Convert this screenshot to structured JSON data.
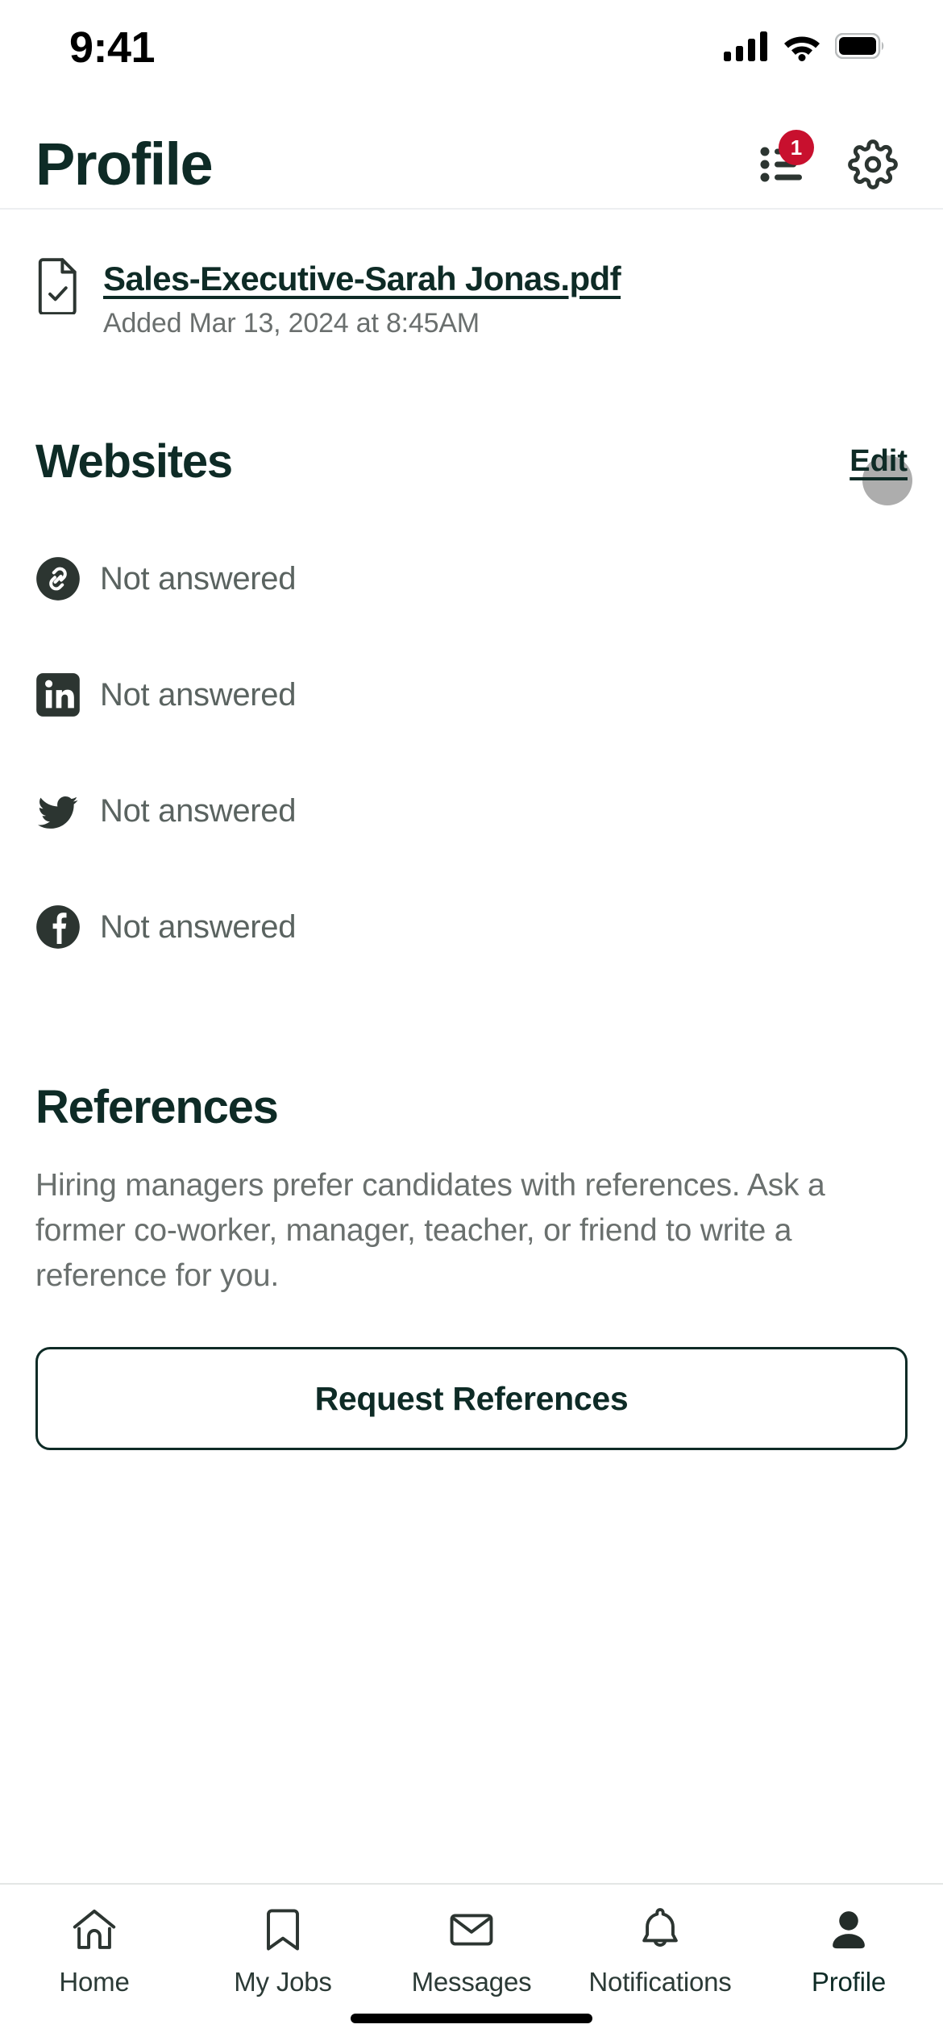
{
  "status_bar": {
    "time": "9:41",
    "icons": [
      "cellular-signal-icon",
      "wifi-icon",
      "battery-icon"
    ]
  },
  "header": {
    "title": "Profile",
    "activity_icon": "activity-list-icon",
    "activity_badge_count": "1",
    "settings_icon": "gear-icon"
  },
  "resume": {
    "file_icon": "document-check-icon",
    "file_name": "Sales-Executive-Sarah Jonas.pdf",
    "added_text": "Added Mar 13, 2024 at 8:45AM"
  },
  "websites": {
    "title": "Websites",
    "edit_label": "Edit",
    "rows": [
      {
        "icon": "link-icon",
        "value": "Not answered"
      },
      {
        "icon": "linkedin-icon",
        "value": "Not answered"
      },
      {
        "icon": "twitter-icon",
        "value": "Not answered"
      },
      {
        "icon": "facebook-icon",
        "value": "Not answered"
      }
    ]
  },
  "references": {
    "title": "References",
    "description": "Hiring managers prefer candidates with references. Ask a former co-worker, manager, teacher, or friend to write a reference for you.",
    "button_label": "Request References"
  },
  "tab_bar": {
    "items": [
      {
        "label": "Home",
        "icon": "home-icon",
        "active": false
      },
      {
        "label": "My Jobs",
        "icon": "bookmark-icon",
        "active": false
      },
      {
        "label": "Messages",
        "icon": "envelope-icon",
        "active": false
      },
      {
        "label": "Notifications",
        "icon": "bell-icon",
        "active": false
      },
      {
        "label": "Profile",
        "icon": "person-icon",
        "active": true
      }
    ]
  },
  "colors": {
    "brand_dark_green": "#0E2B26",
    "badge_red": "#C8102E",
    "muted_text": "#6A706E",
    "icon_dark": "#333B38"
  }
}
